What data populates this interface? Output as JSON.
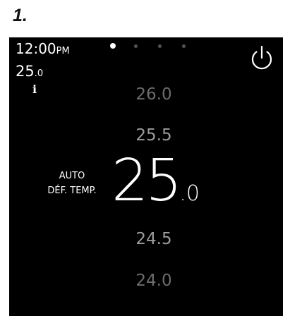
{
  "step": {
    "label": "1."
  },
  "status": {
    "time": "12:00",
    "time_suffix": "PM",
    "current_temp_int": "25",
    "current_temp_dec": ".0"
  },
  "icons": {
    "info": "info-icon",
    "power": "power-icon",
    "info_glyph": "i"
  },
  "pager": {
    "count": 4,
    "active_index": 0
  },
  "mode": {
    "line1": "AUTO",
    "line2": "DÉF. TEMP."
  },
  "setpoint": {
    "int": "25",
    "dec": ".0"
  },
  "temp_options": {
    "above_far": "26.0",
    "above_near": "25.5",
    "below_near": "24.5",
    "below_far": "24.0"
  }
}
